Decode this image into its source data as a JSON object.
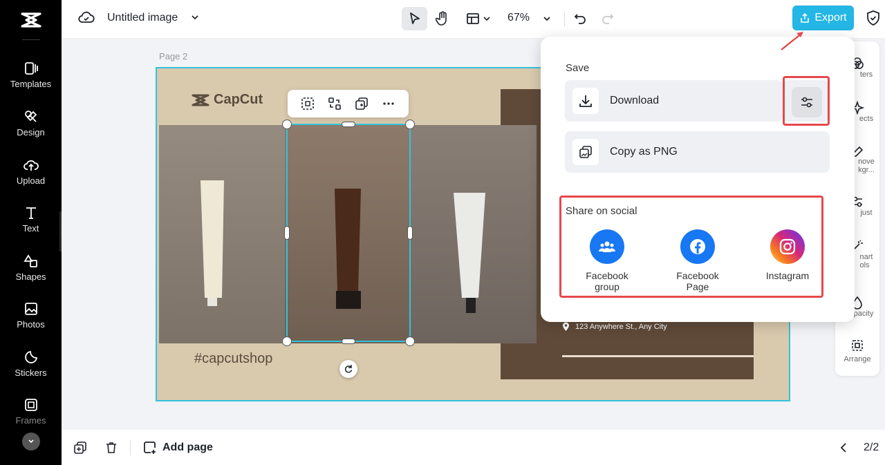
{
  "sidebar": {
    "items": [
      {
        "label": "Templates",
        "icon": "templates-icon"
      },
      {
        "label": "Design",
        "icon": "design-icon"
      },
      {
        "label": "Upload",
        "icon": "upload-icon"
      },
      {
        "label": "Text",
        "icon": "text-icon"
      },
      {
        "label": "Shapes",
        "icon": "shapes-icon"
      },
      {
        "label": "Photos",
        "icon": "photos-icon"
      },
      {
        "label": "Stickers",
        "icon": "stickers-icon"
      },
      {
        "label": "Frames",
        "icon": "frames-icon"
      }
    ]
  },
  "topbar": {
    "title": "Untitled image",
    "zoom": "67%",
    "export_label": "Export",
    "accent_color": "#24b6e5"
  },
  "canvas": {
    "page_label": "Page 2",
    "brand": "CapCut",
    "hashtag": "#capcutshop",
    "address": "123 Anywhere St., Any City"
  },
  "right_panel": {
    "items": [
      "ters",
      "ects",
      "nove\nkgr...",
      "just",
      "nart\nols",
      "pacity",
      "Arrange"
    ]
  },
  "export_panel": {
    "save_title": "Save",
    "download_label": "Download",
    "copy_label": "Copy as PNG",
    "social_title": "Share on social",
    "social": [
      {
        "label": "Facebook\ngroup",
        "color": "#1877f2"
      },
      {
        "label": "Facebook\nPage",
        "color": "#1877f2"
      },
      {
        "label": "Instagram",
        "color": "#e1306c"
      }
    ],
    "highlight_color": "#e5484d"
  },
  "bottombar": {
    "add_page_label": "Add page",
    "page_count": "2/2"
  }
}
